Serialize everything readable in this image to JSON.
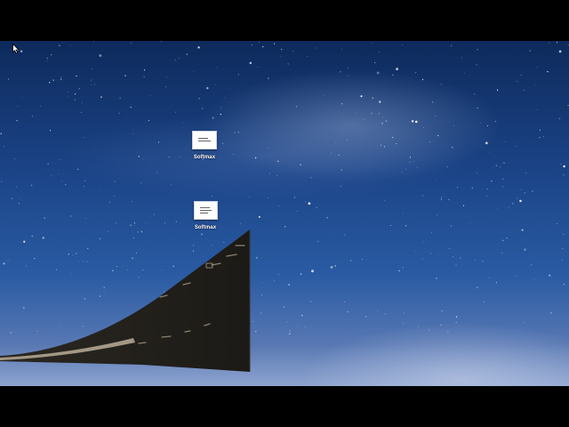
{
  "desktop": {
    "wallpaper": "milky-way-night-sky",
    "icons": [
      {
        "label": "Softmax",
        "icon": "document-thumbnail-icon"
      },
      {
        "label": "Softmax",
        "icon": "document-thumbnail-icon"
      }
    ]
  },
  "cursor": {
    "icon": "arrow-pointer-icon"
  },
  "animation": {
    "name": "window-minimize-genie-effect"
  },
  "colors": {
    "letterbox": "#000000",
    "sky_top": "#0e2a5c",
    "sky_mid": "#2a5ba3",
    "horizon": "#8ea4cf",
    "window_dark": "#1f1d19",
    "window_edge": "#b9ad98"
  }
}
